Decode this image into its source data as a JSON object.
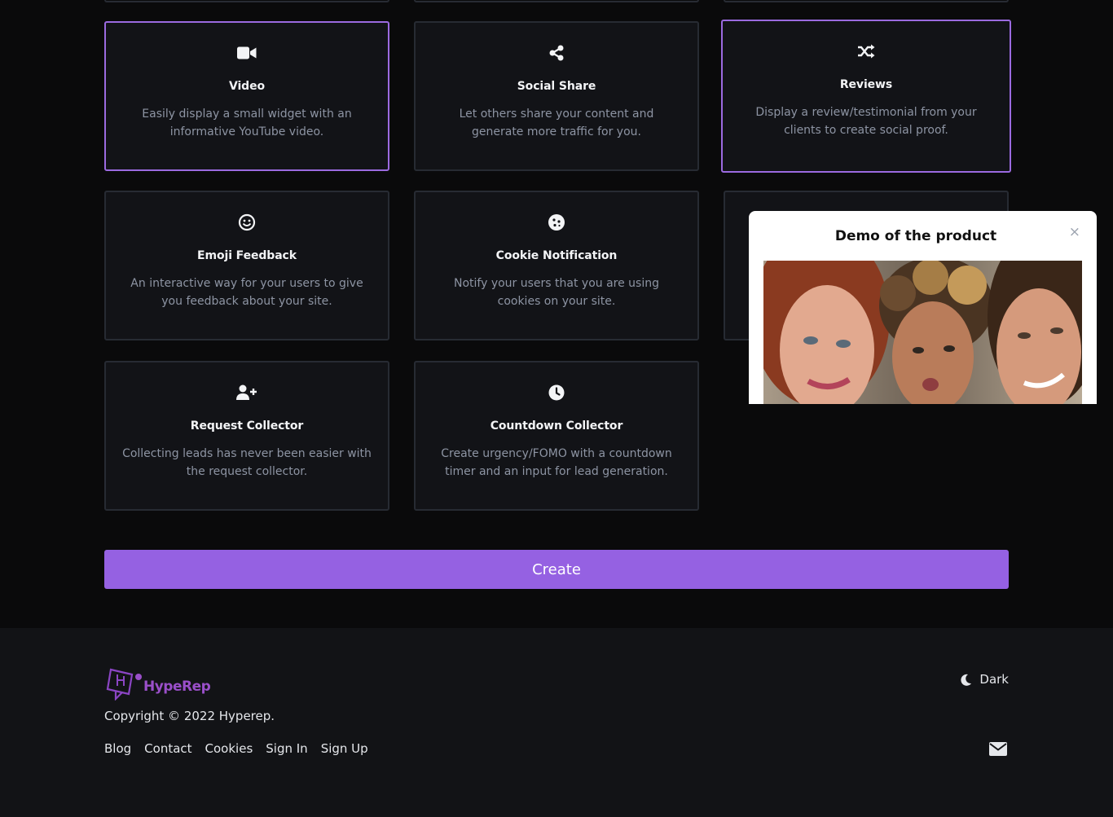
{
  "cards": [
    {
      "icon": "video-camera-icon",
      "title": "Video",
      "desc": "Easily display a small widget with an informative YouTube video."
    },
    {
      "icon": "share-icon",
      "title": "Social Share",
      "desc": "Let others share your content and generate more traffic for you."
    },
    {
      "icon": "shuffle-icon",
      "title": "Reviews",
      "desc": "Display a review/testimonial from your clients to create social proof."
    },
    {
      "icon": "smile-icon",
      "title": "Emoji Feedback",
      "desc": "An interactive way for your users to give you feedback about your site."
    },
    {
      "icon": "cookie-icon",
      "title": "Cookie Notification",
      "desc": "Notify your users that you are using cookies on your site."
    },
    {
      "icon": "user-plus-icon",
      "title": "Request Collector",
      "desc": "Collecting leads has never been easier with the request collector."
    },
    {
      "icon": "clock-icon",
      "title": "Countdown Collector",
      "desc": "Create urgency/FOMO with a countdown timer and an input for lead generation."
    }
  ],
  "create_label": "Create",
  "popup": {
    "title": "Demo of the product",
    "close_icon": "×"
  },
  "footer": {
    "logo_text": "HypeRep",
    "copyright": "Copyright © 2022 Hyperep.",
    "links": [
      "Blog",
      "Contact",
      "Cookies",
      "Sign In",
      "Sign Up"
    ],
    "theme_label": "Dark"
  },
  "colors": {
    "accent": "#9561e2",
    "selected_border": "#9b6ae0",
    "card_bg": "#121317",
    "card_border": "#272b33",
    "page_bg": "#0a0a0b"
  }
}
